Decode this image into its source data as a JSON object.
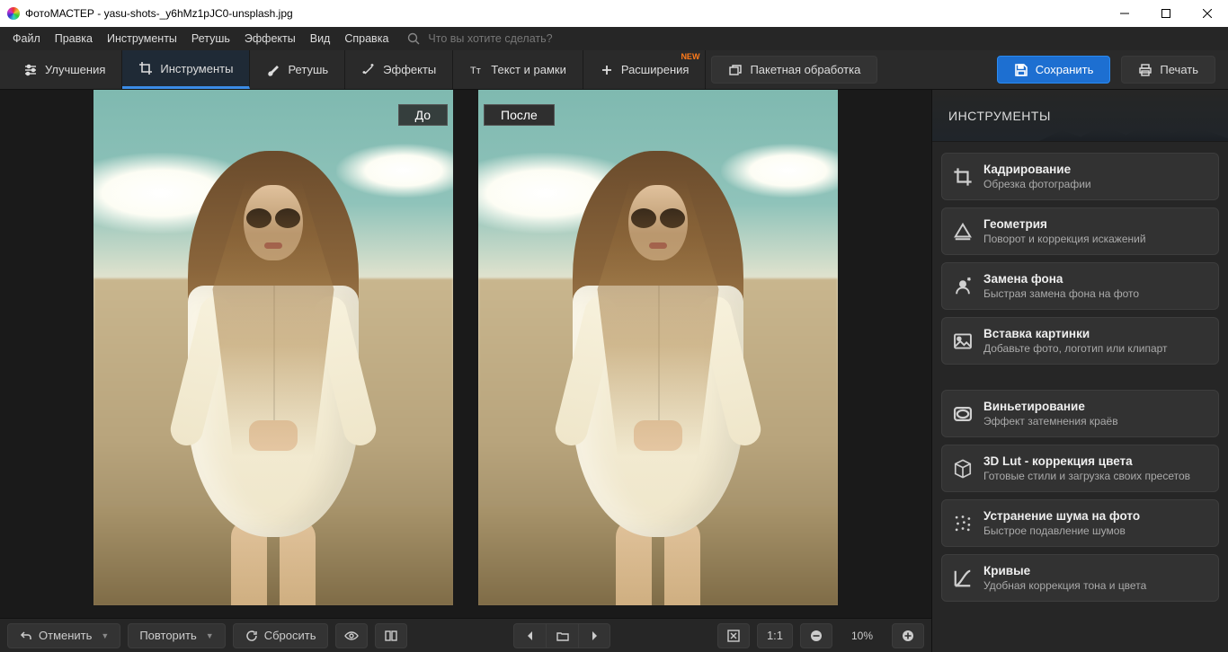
{
  "window": {
    "title": "ФотоМАСТЕР - yasu-shots-_y6hMz1pJC0-unsplash.jpg"
  },
  "menu": {
    "items": [
      "Файл",
      "Правка",
      "Инструменты",
      "Ретушь",
      "Эффекты",
      "Вид",
      "Справка"
    ],
    "search_placeholder": "Что вы хотите сделать?"
  },
  "toolbar": {
    "tabs": [
      {
        "label": "Улучшения"
      },
      {
        "label": "Инструменты"
      },
      {
        "label": "Ретушь"
      },
      {
        "label": "Эффекты"
      },
      {
        "label": "Текст и рамки"
      },
      {
        "label": "Расширения",
        "badge": "NEW"
      }
    ],
    "batch": "Пакетная обработка",
    "save": "Сохранить",
    "print": "Печать"
  },
  "viewer": {
    "before": "До",
    "after": "После"
  },
  "bottombar": {
    "undo": "Отменить",
    "redo": "Повторить",
    "reset": "Сбросить",
    "one_to_one": "1:1",
    "zoom": "10%"
  },
  "rightpanel": {
    "title": "ИНСТРУМЕНТЫ",
    "groups": [
      [
        {
          "title": "Кадрирование",
          "sub": "Обрезка фотографии"
        },
        {
          "title": "Геометрия",
          "sub": "Поворот и коррекция искажений"
        },
        {
          "title": "Замена фона",
          "sub": "Быстрая замена фона на фото"
        },
        {
          "title": "Вставка картинки",
          "sub": "Добавьте фото, логотип или клипарт"
        }
      ],
      [
        {
          "title": "Виньетирование",
          "sub": "Эффект затемнения краёв"
        },
        {
          "title": "3D Lut - коррекция цвета",
          "sub": "Готовые стили и загрузка своих пресетов"
        },
        {
          "title": "Устранение шума на фото",
          "sub": "Быстрое подавление шумов"
        },
        {
          "title": "Кривые",
          "sub": "Удобная коррекция тона и цвета"
        }
      ]
    ]
  }
}
